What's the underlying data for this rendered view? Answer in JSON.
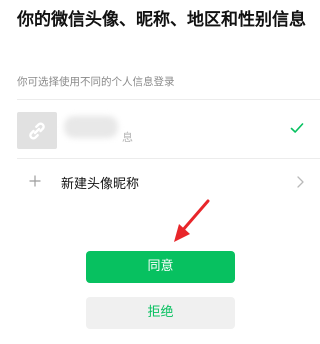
{
  "header": {
    "title": "你的微信头像、昵称、地区和性别信息",
    "subtitle": "你可选择使用不同的个人信息登录"
  },
  "profile_option": {
    "name_suffix": "息",
    "selected": true,
    "avatar_icon": "link-icon",
    "check_icon": "checkmark-icon"
  },
  "new_option": {
    "label": "新建头像昵称",
    "plus_icon": "plus-icon",
    "chevron_icon": "chevron-right-icon"
  },
  "actions": {
    "agree_label": "同意",
    "reject_label": "拒绝"
  },
  "colors": {
    "accent": "#07c160",
    "annotation_arrow": "#e8262a"
  }
}
